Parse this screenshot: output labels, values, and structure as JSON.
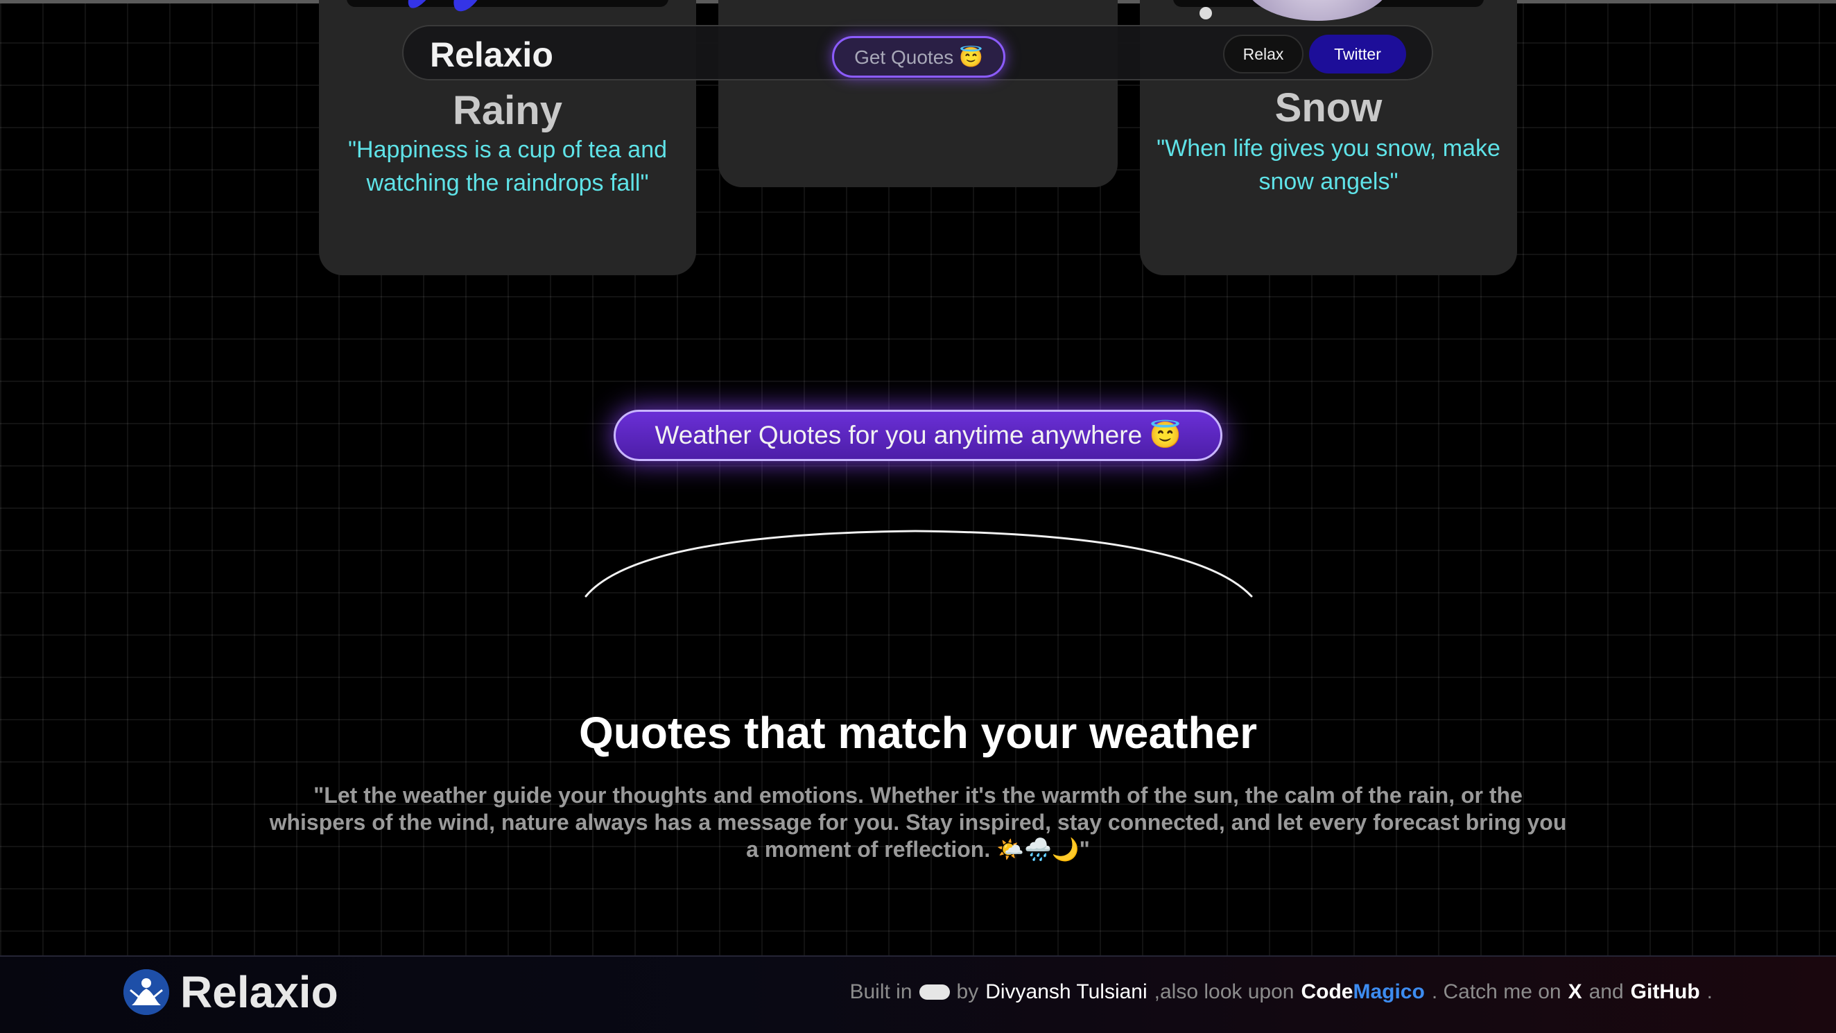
{
  "nav": {
    "brand": "Relaxio",
    "cta_label": "Get Quotes 😇",
    "links": [
      "Relax",
      "Twitter"
    ]
  },
  "cards": [
    {
      "title": "Rainy",
      "quote": "\"Happiness is a cup of tea and watching the raindrops fall\""
    },
    {
      "title": "",
      "quote": ""
    },
    {
      "title": "Snow",
      "quote": "\"When life gives you snow, make snow angels\""
    }
  ],
  "hero": {
    "pill_label": "Weather Quotes for you anytime anywhere 😇"
  },
  "section": {
    "heading": "Quotes that match your weather",
    "paragraph": "\"Let the weather guide your thoughts and emotions. Whether it's the warmth of the sun, the calm of the rain, or the whispers of the wind, nature always has a message for you. Stay inspired, stay connected, and let every forecast bring you a moment of reflection. 🌤️🌧️🌙\""
  },
  "footer": {
    "brand": "Relaxio",
    "built_in": "Built in",
    "by": "by",
    "author": "Divyansh Tulsiani",
    "also": ",also look upon",
    "codemagico_a": "Code",
    "codemagico_b": "Magico",
    "catch": ". Catch me on",
    "x_label": "X",
    "and": "and",
    "github_label": "GitHub",
    "end": "."
  },
  "colors": {
    "accent": "#8c5cff",
    "quote": "#5fe3e8",
    "twitter_btn": "#1d0e99"
  }
}
